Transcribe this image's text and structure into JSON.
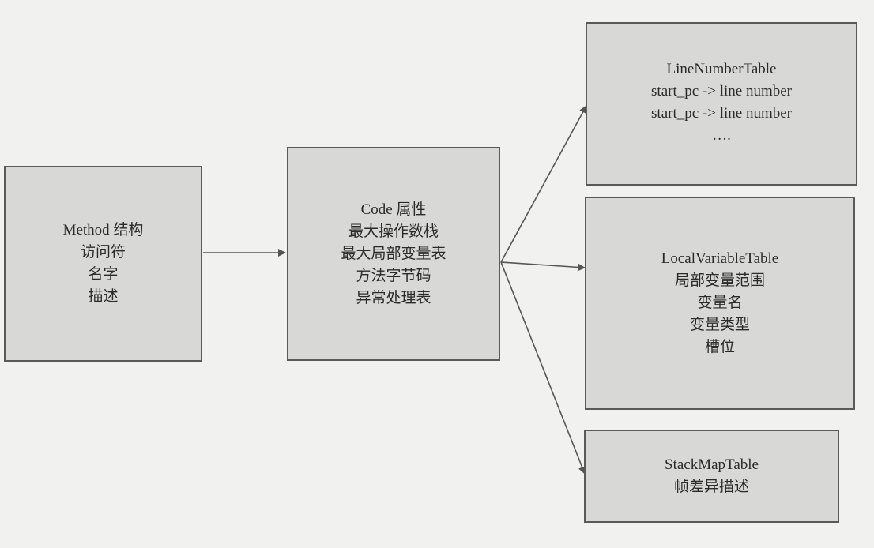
{
  "method_box": {
    "lines": [
      "Method 结构",
      "访问符",
      "名字",
      "描述"
    ]
  },
  "code_box": {
    "lines": [
      "Code 属性",
      "最大操作数栈",
      "最大局部变量表",
      "方法字节码",
      "异常处理表"
    ]
  },
  "line_number_table_box": {
    "lines": [
      "LineNumberTable",
      "start_pc -> line number",
      "start_pc -> line number",
      "…."
    ]
  },
  "local_variable_table_box": {
    "lines": [
      "LocalVariableTable",
      "局部变量范围",
      "变量名",
      "变量类型",
      "槽位"
    ]
  },
  "stack_map_table_box": {
    "lines": [
      "StackMapTable",
      "帧差异描述"
    ]
  },
  "colors": {
    "box_fill": "#d8d8d6",
    "border": "#5a5a5a",
    "background": "#f1f1ef",
    "arrow": "#555555"
  }
}
